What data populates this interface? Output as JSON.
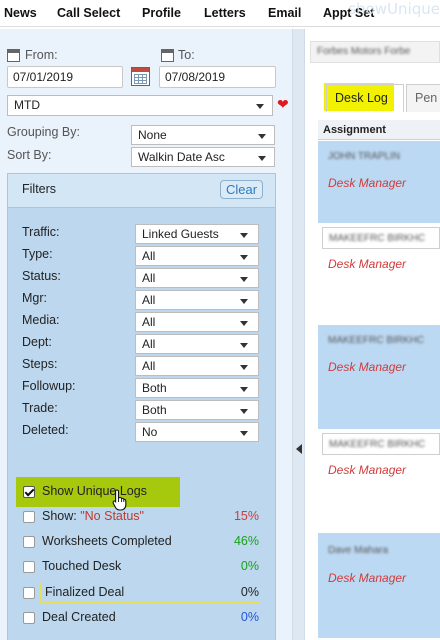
{
  "nav": {
    "items": [
      "News",
      "Call Select",
      "Profile",
      "Letters",
      "Email",
      "Appt Set"
    ],
    "watermark": "showUnique"
  },
  "dates": {
    "from_label": "From:",
    "from_value": "07/01/2019",
    "to_label": "To:",
    "to_value": "07/08/2019",
    "range_preset": "MTD"
  },
  "grouping": {
    "label": "Grouping By:",
    "value": "None"
  },
  "sort": {
    "label": "Sort By:",
    "value": "Walkin Date Asc"
  },
  "filters": {
    "title": "Filters",
    "clear_label": "Clear",
    "rows": [
      {
        "label": "Traffic:",
        "value": "Linked Guests"
      },
      {
        "label": "Type:",
        "value": "All"
      },
      {
        "label": "Status:",
        "value": "All"
      },
      {
        "label": "Mgr:",
        "value": "All"
      },
      {
        "label": "Media:",
        "value": "All"
      },
      {
        "label": "Dept:",
        "value": "All"
      },
      {
        "label": "Steps:",
        "value": "All"
      },
      {
        "label": "Followup:",
        "value": "Both"
      },
      {
        "label": "Trade:",
        "value": "Both"
      },
      {
        "label": "Deleted:",
        "value": "No"
      }
    ]
  },
  "checks": [
    {
      "label": "Show Unique Logs",
      "checked": true,
      "pct": ""
    },
    {
      "label": "Show: ",
      "label2": "\"No Status\"",
      "checked": false,
      "pct": "15%"
    },
    {
      "label": "Worksheets Completed",
      "checked": false,
      "pct": "46%"
    },
    {
      "label": "Touched Desk",
      "checked": false,
      "pct": "0%"
    },
    {
      "label": "Finalized Deal",
      "checked": false,
      "pct": "0%"
    },
    {
      "label": "Deal Created",
      "checked": false,
      "pct": "0%"
    }
  ],
  "colors": {
    "pct_red": "#d23a3a",
    "pct_green": "#1aa01a",
    "pct_blue": "#2255dd",
    "highlight_green": "#a6c90e",
    "highlight_yellow": "#f2f200"
  },
  "right": {
    "top_blurred": "Forbes Motors   Forbe",
    "tabs": [
      "Desk Log",
      "Pen"
    ],
    "assignment_header": "Assignment",
    "rows": [
      {
        "name": "JOHN TRAPLIN",
        "role": "Desk Manager"
      },
      {
        "name": "MAKEEFRC BIRKHC",
        "role": "Desk Manager"
      },
      {
        "name": "MAKEEFRC BIRKHC",
        "role": "Desk Manager"
      },
      {
        "name": "MAKEEFRC BIRKHC",
        "role": "Desk Manager"
      },
      {
        "name": "Dave Mahara",
        "role": "Desk Manager"
      }
    ]
  }
}
